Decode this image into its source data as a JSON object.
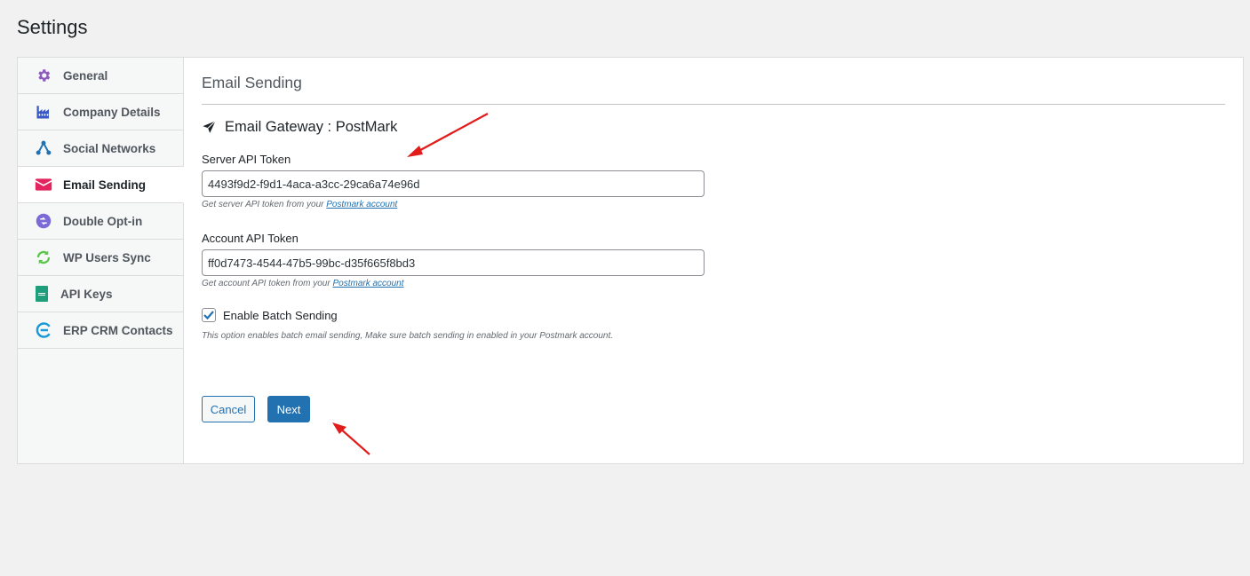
{
  "page": {
    "title": "Settings"
  },
  "sidebar": {
    "items": [
      {
        "label": "General",
        "icon": "gear-icon",
        "active": false
      },
      {
        "label": "Company Details",
        "icon": "factory-icon",
        "active": false
      },
      {
        "label": "Social Networks",
        "icon": "share-icon",
        "active": false
      },
      {
        "label": "Email Sending",
        "icon": "envelope-icon",
        "active": true
      },
      {
        "label": "Double Opt-in",
        "icon": "double-optin-icon",
        "active": false
      },
      {
        "label": "WP Users Sync",
        "icon": "sync-icon",
        "active": false
      },
      {
        "label": "API Keys",
        "icon": "api-doc-icon",
        "active": false
      },
      {
        "label": "ERP CRM Contacts",
        "icon": "erp-crm-icon",
        "active": false
      }
    ]
  },
  "main": {
    "section_title": "Email Sending",
    "gateway_heading": "Email Gateway : PostMark",
    "server_token": {
      "label": "Server API Token",
      "value": "4493f9d2-f9d1-4aca-a3cc-29ca6a74e96d",
      "help_prefix": "Get server API token from your",
      "help_link": "Postmark account"
    },
    "account_token": {
      "label": "Account API Token",
      "value": "ff0d7473-4544-47b5-99bc-d35f665f8bd3",
      "help_prefix": "Get account API token from your",
      "help_link": "Postmark account"
    },
    "batch": {
      "label": "Enable Batch Sending",
      "checked": true,
      "help": "This option enables batch email sending, Make sure batch sending in enabled in your Postmark account."
    },
    "buttons": {
      "cancel": "Cancel",
      "next": "Next"
    }
  },
  "colors": {
    "accent": "#2271b1",
    "annotation_arrow": "#e21b1b",
    "active_email_icon": "#e4245f"
  }
}
